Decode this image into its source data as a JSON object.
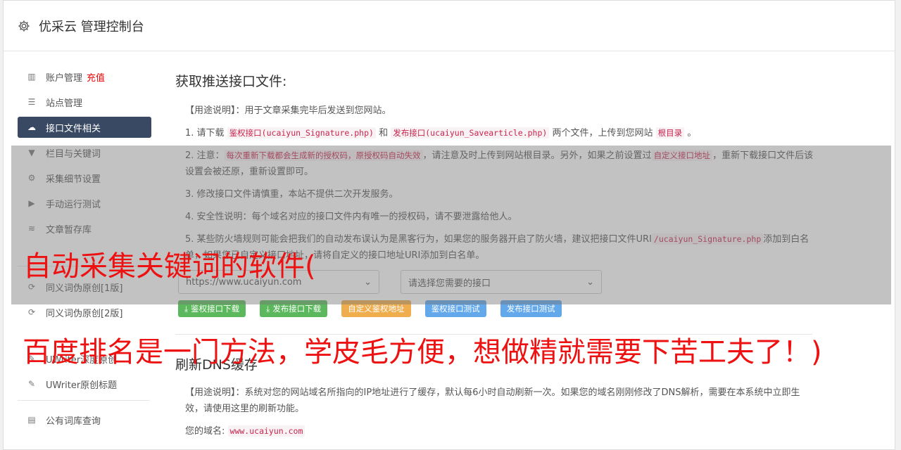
{
  "header": {
    "title": "优采云 管理控制台",
    "icon": "gear-icon"
  },
  "sidebar": {
    "items": [
      {
        "label": "账户管理",
        "extra": "充值",
        "icon": "bar-chart-icon"
      },
      {
        "label": "站点管理",
        "icon": "server-icon"
      },
      {
        "label": "接口文件相关",
        "icon": "cloud-upload-icon"
      },
      {
        "label": "栏目与关键词",
        "icon": "filter-icon"
      },
      {
        "label": "采集细节设置",
        "icon": "cogs-icon"
      },
      {
        "label": "手动运行测试",
        "icon": "play-icon"
      },
      {
        "label": "文章暂存库",
        "icon": "database-icon"
      },
      {
        "label": "同义词伪原创[1版]",
        "icon": "refresh-icon"
      },
      {
        "label": "同义词伪原创[2版]",
        "icon": "refresh-icon"
      },
      {
        "label": "UWriter深度原创",
        "icon": "edit-icon"
      },
      {
        "label": "UWriter原创标题",
        "icon": "edit-icon"
      },
      {
        "label": "公有词库查询",
        "icon": "book-icon"
      }
    ]
  },
  "main": {
    "section1": {
      "title": "获取推送接口文件:",
      "usage_label": "【用途说明】",
      "usage_text": "：用于文章采集完毕后发送到您网站。",
      "step1_a": "1. 请下载",
      "step1_code1": "鉴权接口(ucaiyun_Signature.php)",
      "step1_b": "和",
      "step1_code2": "发布接口(ucaiyun_Savearticle.php)",
      "step1_c": "两个文件，上传到您网站",
      "step1_code3": "根目录",
      "step1_d": "。",
      "step2_a": "2. 注意：",
      "step2_code1": "每次重新下载都会生成新的授权码，原授权码自动失效",
      "step2_b": "，请注意及时上传到网站根目录。另外，如果之前设置过",
      "step2_code2": "自定义接口地址",
      "step2_c": "，重新下载接口文件后该设置会被还原，重新设置即可。",
      "step3": "3. 修改接口文件请慎重，本站不提供二次开发服务。",
      "step4": "4. 安全性说明：每个域名对应的接口文件内有唯一的授权码，请不要泄露给他人。",
      "step5_a": "5. 某些防火墙规则可能会把我们的自动发布误认为是黑客行为，如果您的服务器开启了防火墙，建议把接口文件URI",
      "step5_code": "/ucaiyun_Signature.php",
      "step5_b": "添加到白名单，如果您已自定义接口地址，请将自定义的接口地址URI添加到白名单。",
      "select_site": "https://www.ucaiyun.com",
      "select_api_placeholder": "请选择您需要的接口",
      "buttons": {
        "download_auth": "鉴权接口下载",
        "download_publish": "发布接口下载",
        "custom_auth": "自定义鉴权地址",
        "test_auth": "鉴权接口测试",
        "test_publish": "发布接口测试"
      }
    },
    "section2": {
      "title": "刷新DNS缓存",
      "usage_label": "【用途说明】",
      "usage_text": "：系统对您的网站域名所指向的IP地址进行了缓存，默认每6小时自动刷新一次。如果您的域名刚刚修改了DNS解析，需要在本系统中立即生效，请使用这里的刷新功能。",
      "domain_label": "您的域名:",
      "domain_value": "www.ucaiyun.com"
    }
  },
  "overlay_text": {
    "line1": "自动采集关键词的软件(",
    "line2": "百度排名是一门方法，学皮毛方便，想做精就需要下苦工夫了！)"
  },
  "colors": {
    "accent": "#3a4963",
    "overlay_red": "#ee1111",
    "green": "#5cb85c",
    "orange": "#f0ad4e",
    "blue": "#62a8ea"
  }
}
